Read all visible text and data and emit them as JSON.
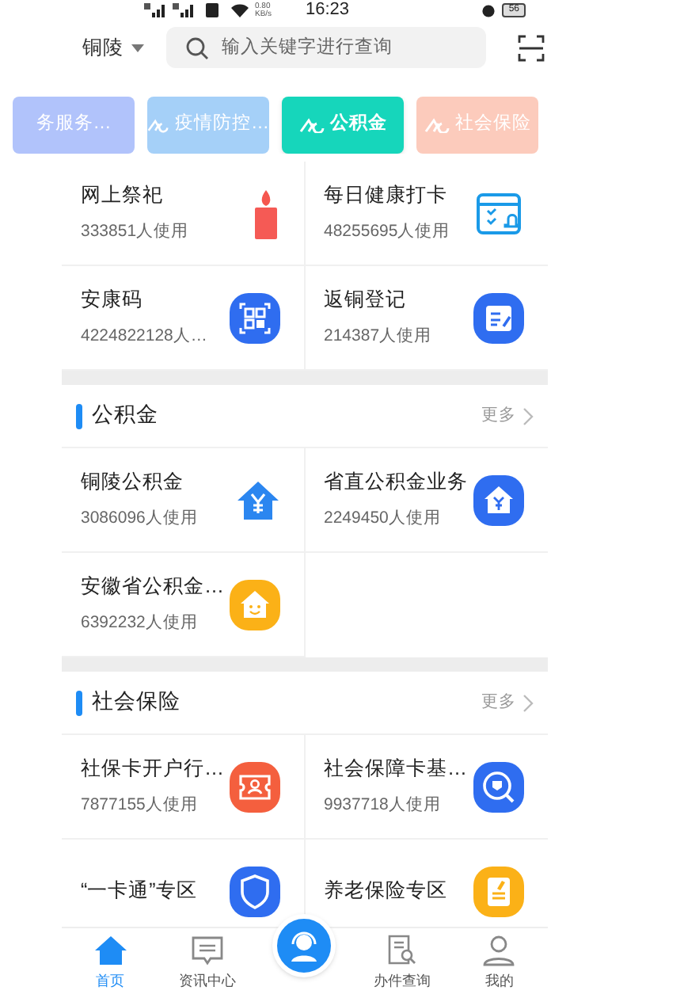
{
  "status_bar": {
    "network": "0.80 KB/s",
    "time": "16:23",
    "battery": "56"
  },
  "header": {
    "city": "铜陵",
    "search": {
      "placeholder": "输入关键字进行查询"
    }
  },
  "chips": [
    {
      "label": "务服务…",
      "selected": false,
      "color": "#a9bdfb"
    },
    {
      "label": "疫情防控…",
      "selected": false,
      "color": "#9ccbf8"
    },
    {
      "label": "公积金",
      "selected": true,
      "color": "#16d6bb"
    },
    {
      "label": "社会保险",
      "selected": false,
      "color": "#fcc6b5"
    }
  ],
  "sections": [
    {
      "services": [
        {
          "name": "网上祭祀",
          "users": "333851人使用"
        },
        {
          "name": "每日健康打卡",
          "users": "48255695人使用"
        },
        {
          "name": "安康码",
          "users": "4224822128人…"
        },
        {
          "name": "返铜登记",
          "users": "214387人使用"
        }
      ]
    },
    {
      "title": "公积金",
      "more": "更多",
      "services": [
        {
          "name": "铜陵公积金",
          "users": "3086096人使用"
        },
        {
          "name": "省直公积金业务",
          "users": "2249450人使用"
        },
        {
          "name": "安徽省公积金…",
          "users": "6392232人使用"
        }
      ]
    },
    {
      "title": "社会保险",
      "more": "更多",
      "services": [
        {
          "name": "社保卡开户行…",
          "users": "7877155人使用"
        },
        {
          "name": "社会保障卡基…",
          "users": "9937718人使用"
        },
        {
          "name": "“一卡通”专区"
        },
        {
          "name": "养老保险专区"
        }
      ]
    }
  ],
  "bottom_nav": [
    {
      "label": "首页",
      "selected": true
    },
    {
      "label": "资讯中心",
      "selected": false
    },
    {
      "label": "办件查询",
      "selected": false
    },
    {
      "label": "我的",
      "selected": false
    }
  ]
}
